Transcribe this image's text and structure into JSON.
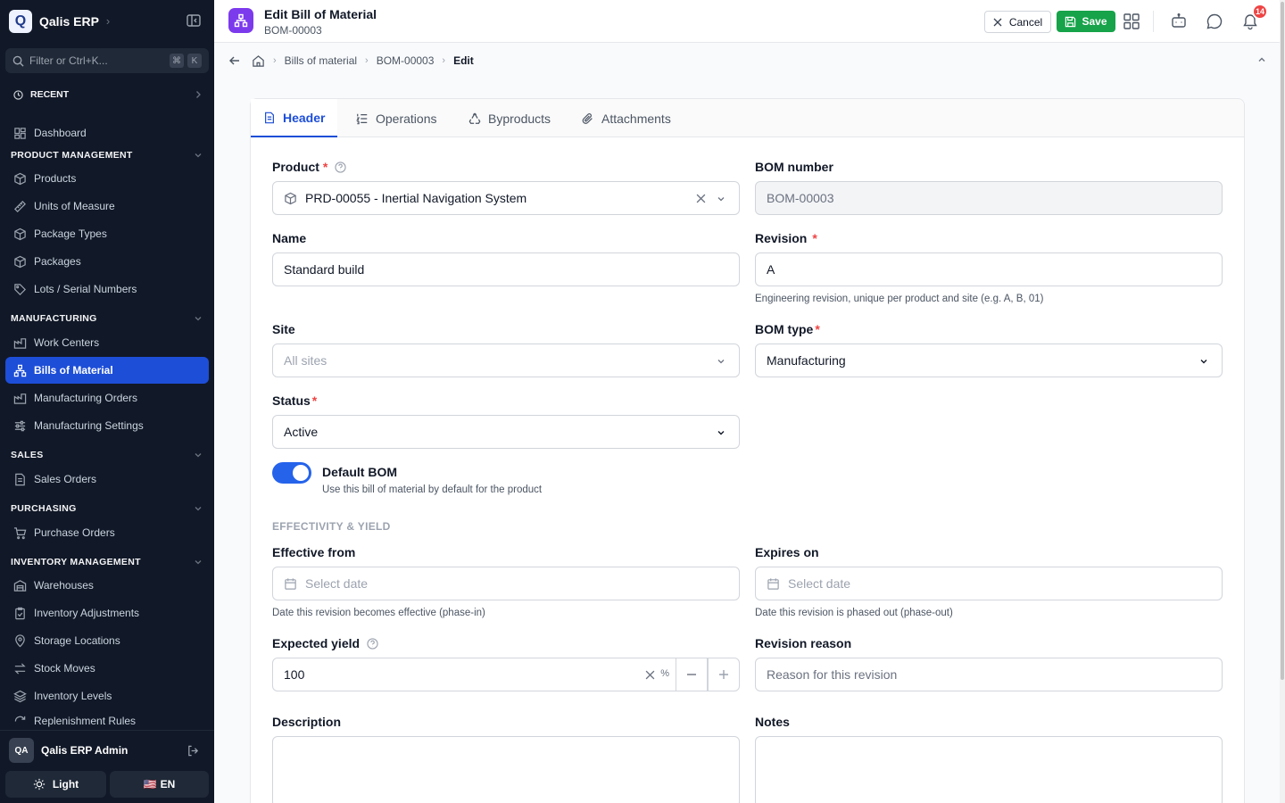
{
  "app": {
    "logo_letter": "Q",
    "name": "Qalis ERP"
  },
  "sidebar": {
    "filter_placeholder": "Filter or Ctrl+K...",
    "kbd_1": "⌘",
    "kbd_2": "K",
    "recent_label": "RECENT",
    "dashboard": "Dashboard",
    "sections": {
      "product": "PRODUCT MANAGEMENT",
      "manufacturing": "MANUFACTURING",
      "sales": "SALES",
      "purchasing": "PURCHASING",
      "inventory": "INVENTORY MANAGEMENT"
    },
    "items": {
      "products": "Products",
      "uom": "Units of Measure",
      "package_types": "Package Types",
      "packages": "Packages",
      "lots": "Lots / Serial Numbers",
      "work_centers": "Work Centers",
      "bom": "Bills of Material",
      "mo": "Manufacturing Orders",
      "mfg_settings": "Manufacturing Settings",
      "sales_orders": "Sales Orders",
      "purchase_orders": "Purchase Orders",
      "warehouses": "Warehouses",
      "inv_adj": "Inventory Adjustments",
      "storage": "Storage Locations",
      "stock_moves": "Stock Moves",
      "inv_levels": "Inventory Levels",
      "replenishment": "Replenishment Rules"
    },
    "user": {
      "initials": "QA",
      "name": "Qalis ERP Admin"
    },
    "theme_label": "Light",
    "lang_flag": "🇺🇸",
    "lang_label": "EN"
  },
  "topbar": {
    "title": "Edit Bill of Material",
    "subtitle": "BOM-00003",
    "cancel_label": "Cancel",
    "save_label": "Save",
    "notification_count": "14"
  },
  "breadcrumb": {
    "item1": "Bills of material",
    "item2": "BOM-00003",
    "current": "Edit"
  },
  "tabs": {
    "header": "Header",
    "operations": "Operations",
    "byproducts": "Byproducts",
    "attachments": "Attachments"
  },
  "form": {
    "product_label": "Product",
    "product_value": "PRD-00055 - Inertial Navigation System",
    "bom_number_label": "BOM number",
    "bom_number_value": "BOM-00003",
    "name_label": "Name",
    "name_value": "Standard build",
    "revision_label": "Revision",
    "revision_value": "A",
    "revision_help": "Engineering revision, unique per product and site (e.g. A, B, 01)",
    "site_label": "Site",
    "site_placeholder": "All sites",
    "bom_type_label": "BOM type",
    "bom_type_value": "Manufacturing",
    "status_label": "Status",
    "status_value": "Active",
    "default_bom_label": "Default BOM",
    "default_bom_help": "Use this bill of material by default for the product",
    "default_bom_on": true,
    "section_effectivity": "EFFECTIVITY & YIELD",
    "effective_from_label": "Effective from",
    "effective_from_placeholder": "Select date",
    "effective_from_help": "Date this revision becomes effective (phase-in)",
    "expires_on_label": "Expires on",
    "expires_on_placeholder": "Select date",
    "expires_on_help": "Date this revision is phased out (phase-out)",
    "yield_label": "Expected yield",
    "yield_value": "100",
    "yield_unit": "%",
    "revision_reason_label": "Revision reason",
    "revision_reason_placeholder": "Reason for this revision",
    "description_label": "Description",
    "notes_label": "Notes",
    "required_mark": "*"
  },
  "colors": {
    "accent": "#1d4ed8",
    "sidebar_bg": "#111827",
    "save": "#16a34a",
    "page_icon": "#7c3aed",
    "danger": "#ef4444"
  }
}
